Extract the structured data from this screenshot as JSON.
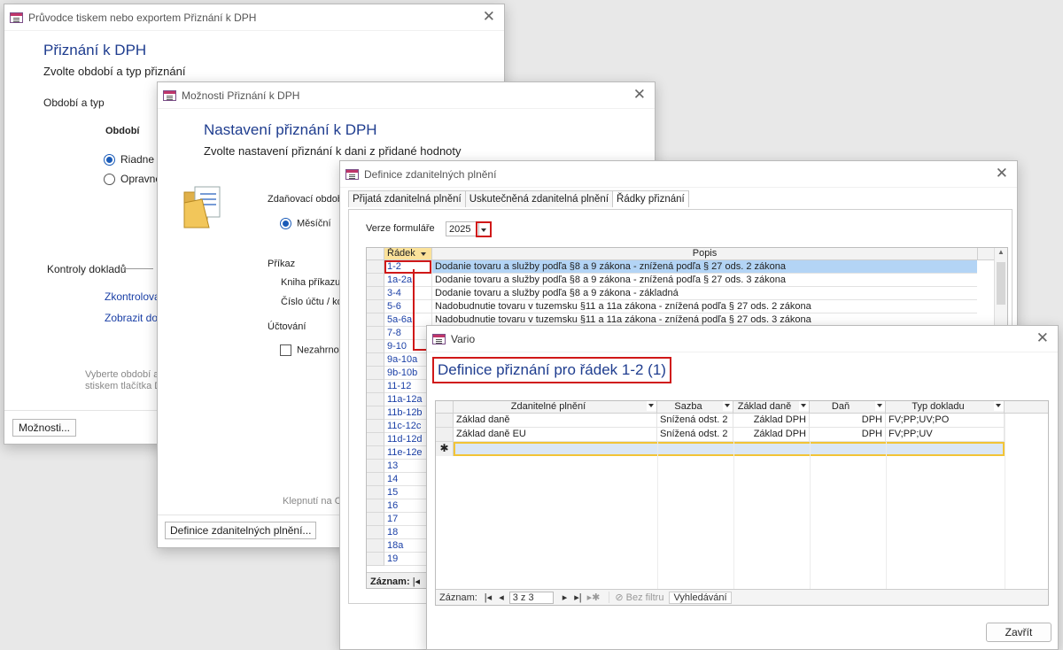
{
  "win1": {
    "title": "Průvodce tiskem nebo exportem Přiznání k DPH",
    "heading": "Přiznání k DPH",
    "subheading": "Zvolte období a typ přiznání",
    "section_period_type": "Období a typ",
    "period_label": "Období",
    "radio_regular": "Riadne",
    "radio_corrective": "Opravné",
    "section_checks": "Kontroly dokladů",
    "link_check": "Zkontrolovat",
    "link_show": "Zobrazit dok",
    "hint_line1": "Vyberte období a",
    "hint_line2": "stiskem tlačítka D",
    "options_button": "Možnosti..."
  },
  "win2": {
    "title": "Možnosti Přiznání k DPH",
    "heading": "Nastavení přiznání k DPH",
    "subheading": "Zvolte nastavení přiznání k dani z přidané hodnoty",
    "tax_period_label": "Zdaňovací obdob",
    "monthly_radio": "Měsíční",
    "order_label": "Příkaz",
    "book_label": "Kniha příkazu",
    "account_label": "Číslo účtu / kó",
    "accounting_label": "Účtování",
    "exclude_checkbox": "Nezahrnov",
    "footer_hint": "Klepnutí na O",
    "definitions_button": "Definice zdanitelných plnění..."
  },
  "win3": {
    "title": "Definice zdanitelných plnění",
    "tabs": [
      "Přijatá zdanitelná plnění",
      "Uskutečněná zdanitelná plnění",
      "Řádky přiznání"
    ],
    "version_label": "Verze formuláře",
    "version_value": "2025",
    "col_row": "Řádek",
    "col_desc": "Popis",
    "rows": [
      {
        "row": "1-2",
        "desc": "Dodanie tovaru a služby podľa §8 a 9 zákona - znížená podľa § 27 ods. 2 zákona"
      },
      {
        "row": "1a-2a",
        "desc": "Dodanie tovaru a služby podľa §8 a 9 zákona - znížená podľa § 27 ods. 3 zákona"
      },
      {
        "row": "3-4",
        "desc": "Dodanie tovaru a služby podľa §8 a 9 zákona - základná"
      },
      {
        "row": "5-6",
        "desc": "Nadobudnutie tovaru v tuzemsku §11 a 11a zákona - znížená podľa § 27 ods. 2 zákona"
      },
      {
        "row": "5a-6a",
        "desc": "Nadobudnutie tovaru v tuzemsku §11 a 11a zákona - znížená podľa § 27 ods. 3 zákona"
      },
      {
        "row": "7-8",
        "desc": ""
      },
      {
        "row": "9-10",
        "desc": ""
      },
      {
        "row": "9a-10a",
        "desc": ""
      },
      {
        "row": "9b-10b",
        "desc": ""
      },
      {
        "row": "11-12",
        "desc": ""
      },
      {
        "row": "11a-12a",
        "desc": ""
      },
      {
        "row": "11b-12b",
        "desc": ""
      },
      {
        "row": "11c-12c",
        "desc": ""
      },
      {
        "row": "11d-12d",
        "desc": ""
      },
      {
        "row": "11e-12e",
        "desc": ""
      },
      {
        "row": "13",
        "desc": ""
      },
      {
        "row": "14",
        "desc": ""
      },
      {
        "row": "15",
        "desc": ""
      },
      {
        "row": "16",
        "desc": ""
      },
      {
        "row": "17",
        "desc": ""
      },
      {
        "row": "18",
        "desc": ""
      },
      {
        "row": "18a",
        "desc": ""
      },
      {
        "row": "19",
        "desc": ""
      }
    ],
    "record_label": "Záznam:"
  },
  "win4": {
    "title": "Vario",
    "heading": "Definice přiznání pro řádek 1-2 (1)",
    "columns": [
      "Zdanitelné plnění",
      "Sazba",
      "Základ daně",
      "Daň",
      "Typ dokladu"
    ],
    "rows": [
      {
        "plneni": "Základ daně",
        "sazba": "Snížená odst. 2",
        "zaklad": "Základ DPH",
        "dan": "DPH",
        "typ": "FV;PP;UV;PO"
      },
      {
        "plneni": "Základ daně EU",
        "sazba": "Snížená odst. 2",
        "zaklad": "Základ DPH",
        "dan": "DPH",
        "typ": "FV;PP;UV"
      }
    ],
    "new_row_marker": "✱",
    "record_label": "Záznam:",
    "record_pos": "3 z 3",
    "filter_label": "Bez filtru",
    "search_label": "Vyhledávání",
    "close_button": "Zavřít"
  }
}
